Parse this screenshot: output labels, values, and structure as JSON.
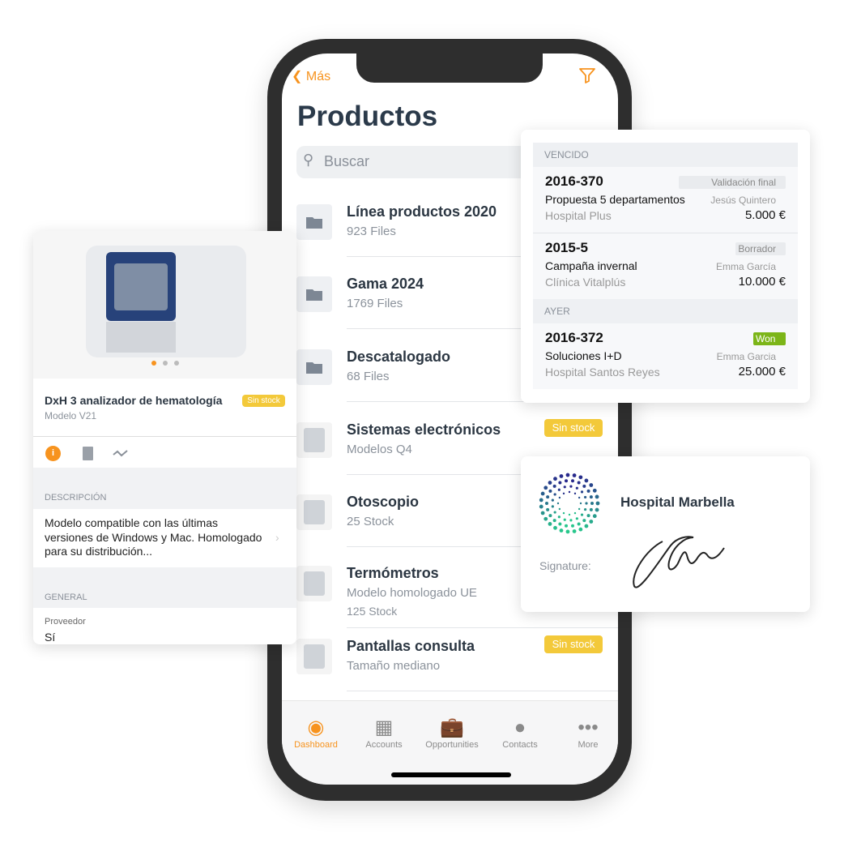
{
  "phone": {
    "back_label": "Más",
    "title": "Productos",
    "search_placeholder": "Buscar",
    "items": [
      {
        "title": "Línea productos 2020",
        "subtitle": "923 Files",
        "icon": "folder-icon"
      },
      {
        "title": "Gama 2024",
        "subtitle": "1769 Files",
        "icon": "folder-icon"
      },
      {
        "title": "Descatalogado",
        "subtitle": "68 Files",
        "icon": "folder-icon"
      },
      {
        "title": "Sistemas electrónicos",
        "subtitle": "Modelos Q4",
        "badge": "Sin stock",
        "icon": "monitor-device-image"
      },
      {
        "title": "Otoscopio",
        "subtitle": "25 Stock",
        "icon": "otoscope-image"
      },
      {
        "title": "Termómetros",
        "subtitle": "Modelo homologado UE",
        "subtitle2": "125 Stock",
        "icon": "thermometer-image"
      },
      {
        "title": "Pantallas consulta",
        "subtitle": "Tamaño mediano",
        "badge": "Sin stock",
        "icon": "ultrasound-image"
      }
    ],
    "tabs": [
      {
        "label": "Dashboard",
        "icon": "dashboard-icon",
        "active": true
      },
      {
        "label": "Accounts",
        "icon": "building-icon"
      },
      {
        "label": "Opportunities",
        "icon": "briefcase-icon"
      },
      {
        "label": "Contacts",
        "icon": "person-icon"
      },
      {
        "label": "More",
        "icon": "more-icon"
      }
    ]
  },
  "product": {
    "name": "DxH 3 analizador de hematología",
    "model": "Modelo V21",
    "badge": "Sin stock",
    "description_header": "DESCRIPCIÓN",
    "description": "Modelo compatible con las últimas versiones de Windows y Mac. Homologado para su distribución...",
    "general_header": "GENERAL",
    "provider_label": "Proveedor",
    "provider_value": "Sí"
  },
  "opportunities": {
    "sections": [
      {
        "header": "VENCIDO",
        "rows": [
          {
            "id": "2016-370",
            "desc": "Propuesta 5 departamentos",
            "client": "Hospital Plus",
            "status": "Validación final",
            "person": "Jesús Quintero",
            "amount": "5.000 €"
          },
          {
            "id": "2015-5",
            "desc": "Campaña invernal",
            "client": "Clínica Vitalplús",
            "status": "Borrador",
            "person": "Emma García",
            "amount": "10.000 €"
          }
        ]
      },
      {
        "header": "AYER",
        "rows": [
          {
            "id": "2016-372",
            "desc": "Soluciones I+D",
            "client": "Hospital Santos Reyes",
            "status": "Won",
            "person": "Emma Garcia",
            "amount": "25.000 €"
          }
        ]
      }
    ]
  },
  "signature_card": {
    "hospital": "Hospital Marbella",
    "signature_label": "Signature:"
  },
  "colors": {
    "accent": "#f7931e",
    "badge": "#f3c93a",
    "won": "#7cb518"
  }
}
